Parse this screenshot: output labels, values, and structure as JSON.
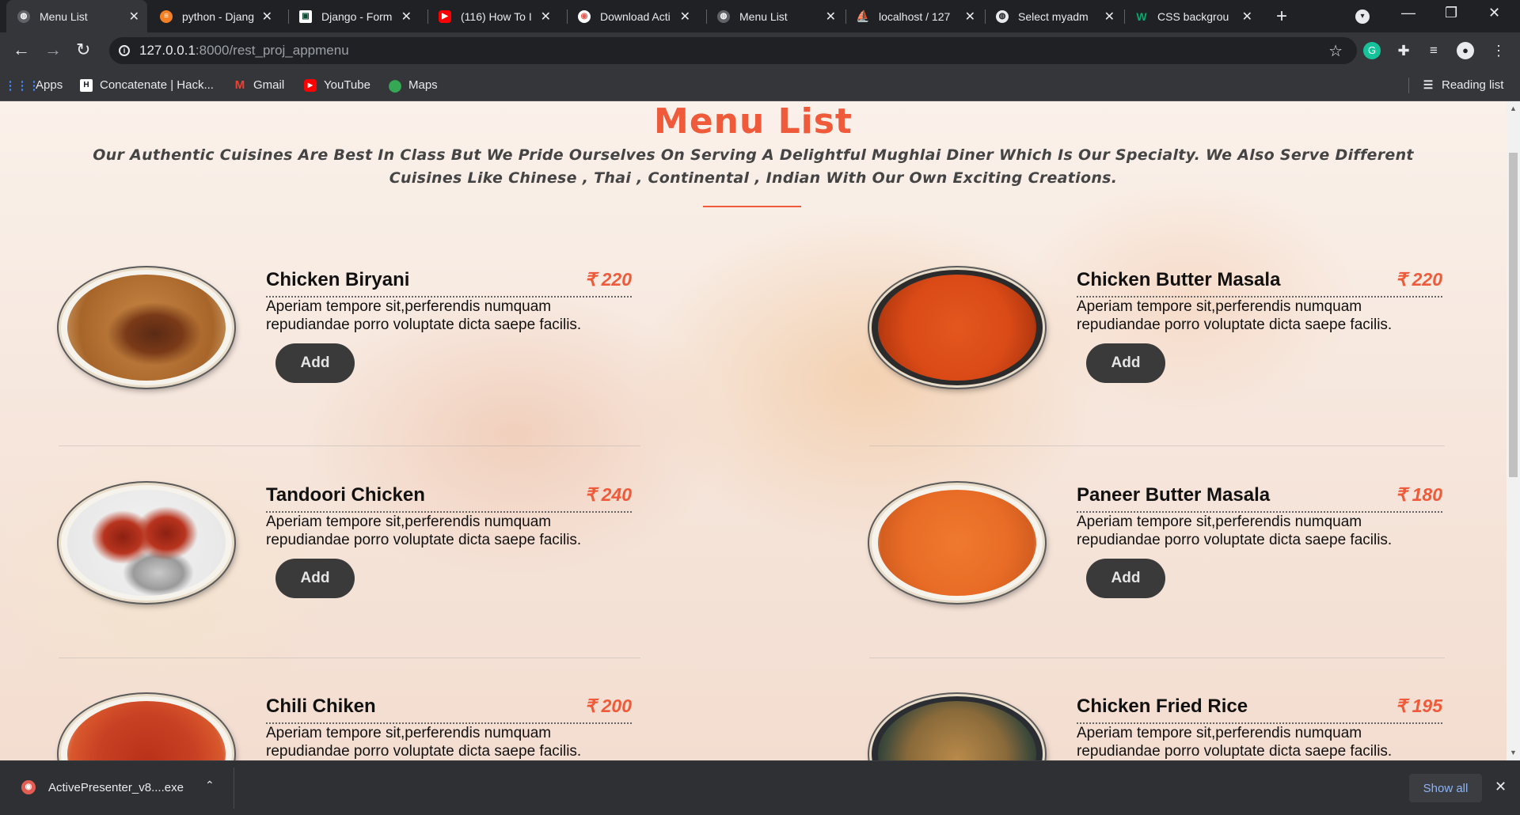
{
  "browser": {
    "tabs": [
      {
        "title": "Menu List",
        "icon": "globe-icon",
        "active": true
      },
      {
        "title": "python - Djang",
        "icon": "stackoverflow-icon",
        "active": false
      },
      {
        "title": "Django - Form",
        "icon": "django-icon",
        "active": false
      },
      {
        "title": "(116) How To I",
        "icon": "youtube-icon",
        "active": false
      },
      {
        "title": "Download Acti",
        "icon": "activepresenter-icon",
        "active": false
      },
      {
        "title": "Menu List",
        "icon": "globe-icon",
        "active": false
      },
      {
        "title": "localhost / 127",
        "icon": "phpmyadmin-icon",
        "active": false
      },
      {
        "title": "Select myadm",
        "icon": "globe-icon",
        "active": false
      },
      {
        "title": "CSS backgrou",
        "icon": "w3schools-icon",
        "active": false
      }
    ],
    "url_host": "127.0.0.1",
    "url_path": ":8000/rest_proj_appmenu",
    "bookmarks": [
      {
        "label": "Apps",
        "icon": "apps-grid-icon"
      },
      {
        "label": "Concatenate | Hack...",
        "icon": "hackerrank-icon"
      },
      {
        "label": "Gmail",
        "icon": "gmail-icon"
      },
      {
        "label": "YouTube",
        "icon": "youtube-icon"
      },
      {
        "label": "Maps",
        "icon": "maps-pin-icon"
      }
    ],
    "reading_list": "Reading list"
  },
  "page": {
    "title": "Menu List",
    "subtitle": "Our Authentic Cuisines Are Best In Class But We Pride Ourselves On Serving A Delightful Mughlai Diner Which Is Our Specialty. We Also Serve Different Cuisines Like Chinese , Thai , Continental , Indian With Our Own Exciting Creations.",
    "accent_color": "#ef5a3a",
    "add_label": "Add",
    "items": [
      {
        "name": "Chicken Biryani",
        "price": "₹ 220",
        "desc": "Aperiam tempore sit,perferendis numquam repudiandae porro voluptate dicta saepe facilis."
      },
      {
        "name": "Chicken Butter Masala",
        "price": "₹ 220",
        "desc": "Aperiam tempore sit,perferendis numquam repudiandae porro voluptate dicta saepe facilis."
      },
      {
        "name": "Tandoori Chicken",
        "price": "₹ 240",
        "desc": "Aperiam tempore sit,perferendis numquam repudiandae porro voluptate dicta saepe facilis."
      },
      {
        "name": "Paneer Butter Masala",
        "price": "₹ 180",
        "desc": "Aperiam tempore sit,perferendis numquam repudiandae porro voluptate dicta saepe facilis."
      },
      {
        "name": "Chili Chiken",
        "price": "₹ 200",
        "desc": "Aperiam tempore sit,perferendis numquam repudiandae porro voluptate dicta saepe facilis."
      },
      {
        "name": "Chicken Fried Rice",
        "price": "₹ 195",
        "desc": "Aperiam tempore sit,perferendis numquam repudiandae porro voluptate dicta saepe facilis."
      }
    ]
  },
  "download_bar": {
    "file": "ActivePresenter_v8....exe",
    "show_all": "Show all"
  }
}
